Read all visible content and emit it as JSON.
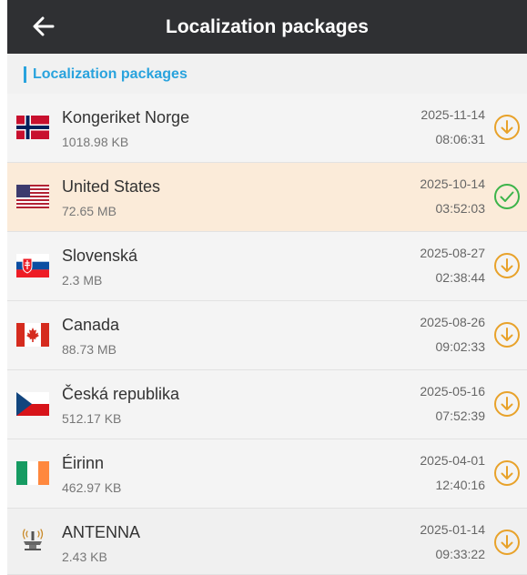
{
  "header": {
    "title": "Localization packages",
    "back_icon": "arrow-left-icon",
    "background": "#2f3033"
  },
  "section": {
    "title": "Localization packages",
    "accent": "#29a3dd"
  },
  "colors": {
    "download": "#e8a22a",
    "installed": "#3cb44a",
    "selected_row": "#fbebd9"
  },
  "packages": [
    {
      "name": "Kongeriket Norge",
      "size": "1018.98 KB",
      "date": "2025-11-14",
      "time": "08:06:31",
      "icon": "flag-norway-icon",
      "status": "download"
    },
    {
      "name": "United States",
      "size": "72.65 MB",
      "date": "2025-10-14",
      "time": "03:52:03",
      "icon": "flag-united-states-icon",
      "status": "installed"
    },
    {
      "name": "Slovenská",
      "size": "2.3 MB",
      "date": "2025-08-27",
      "time": "02:38:44",
      "icon": "flag-slovakia-icon",
      "status": "download"
    },
    {
      "name": "Canada",
      "size": "88.73 MB",
      "date": "2025-08-26",
      "time": "09:02:33",
      "icon": "flag-canada-icon",
      "status": "download"
    },
    {
      "name": "Česká republika",
      "size": "512.17 KB",
      "date": "2025-05-16",
      "time": "07:52:39",
      "icon": "flag-czech-republic-icon",
      "status": "download"
    },
    {
      "name": "Éirinn",
      "size": "462.97 KB",
      "date": "2025-04-01",
      "time": "12:40:16",
      "icon": "flag-ireland-icon",
      "status": "download"
    },
    {
      "name": "ANTENNA",
      "size": "2.43 KB",
      "date": "2025-01-14",
      "time": "09:33:22",
      "icon": "antenna-icon",
      "status": "download"
    }
  ]
}
